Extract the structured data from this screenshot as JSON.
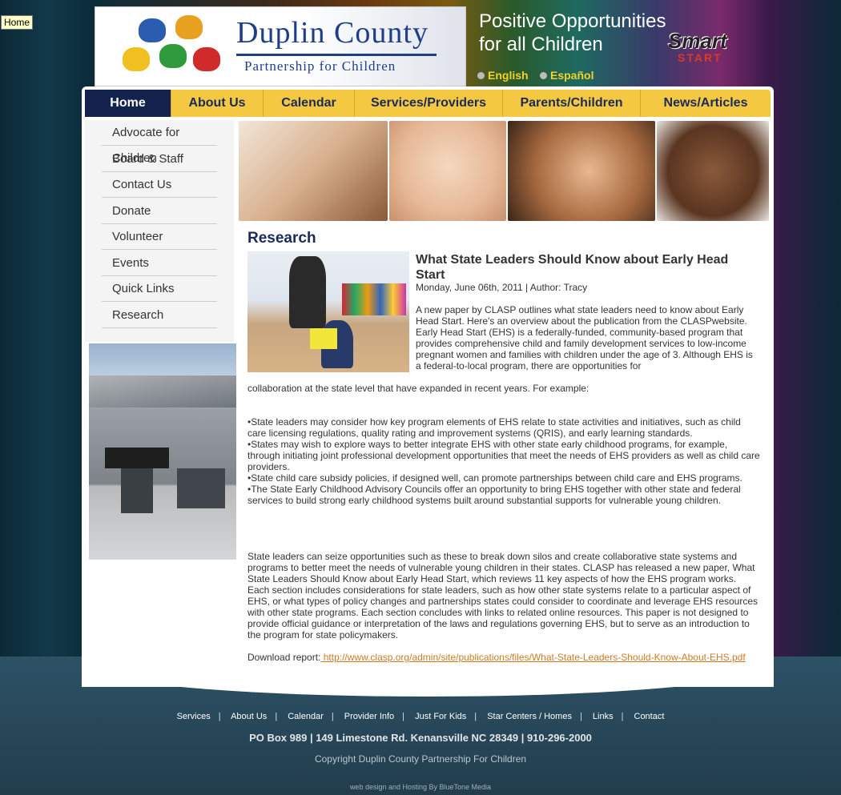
{
  "tooltip": "Home",
  "header": {
    "logo_main": "Duplin County",
    "logo_sub": "Partnership for Children",
    "slogan_line1": "Positive Opportunities",
    "slogan_line2": "for all Children",
    "smart_top": "Smart",
    "smart_bottom": "START",
    "lang_english": "English",
    "lang_spanish": "Español"
  },
  "nav": [
    "Home",
    "About Us",
    "Calendar",
    "Services/Providers",
    "Parents/Children",
    "News/Articles"
  ],
  "sidebar": [
    "Advocate for Children",
    "Board & Staff",
    "Contact Us",
    "Donate",
    "Volunteer",
    "Events",
    "Quick Links",
    "Research"
  ],
  "main": {
    "section_title": "Research",
    "article_title": "What State Leaders Should Know about Early Head Start",
    "meta": "Monday, June 06th, 2011 | Author: Tracy",
    "intro": "A new paper by CLASP outlines what state leaders need to know about Early Head Start. Here's an overview about the publication from the CLASPwebsite. Early Head Start (EHS) is a federally-funded, community-based program that provides comprehensive child and family development services to low-income pregnant women and families with children under the age of 3. Although EHS is a federal-to-local program, there are opportunities for",
    "intro_cont": "collaboration at the state level that have expanded in recent years. For example:",
    "bullets": [
      "•State leaders may consider how key program elements of EHS relate to state activities and initiatives, such as child care licensing regulations, quality rating and improvement systems (QRIS), and early learning standards.",
      "•States may wish to explore ways to better integrate EHS with other state early childhood programs, for example, through initiating joint professional development opportunities that meet the needs of EHS providers as well as child care providers.",
      "•State child care subsidy policies, if designed well, can promote partnerships between child care and EHS programs.",
      "•The State Early Childhood Advisory Councils offer an opportunity to bring EHS together with other state and federal services to build strong early childhood systems built around substantial supports for vulnerable young children."
    ],
    "paragraph": "State leaders can seize opportunities such as these to break down silos and create collaborative state systems and programs to better meet the needs of vulnerable young children in their states. CLASP has released a new paper, What State Leaders Should Know about Early Head Start, which reviews 11 key aspects of how the EHS program works. Each section includes considerations for state leaders, such as how other state systems relate to a particular aspect of EHS, or what types of policy changes and partnerships states could consider to coordinate and leverage EHS resources with other state programs. Each section concludes with links to related online resources. This paper is not designed to provide official guidance or interpretation of the laws and regulations governing EHS, but to serve as an introduction to the program for state policymakers.",
    "download_label": "Download report:",
    "download_link": " http://www.clasp.org/admin/site/publications/files/What-State-Leaders-Should-Know-About-EHS.pdf"
  },
  "footer": {
    "links": [
      "Services",
      "About Us",
      "Calendar",
      "Provider Info",
      "Just For Kids",
      "Star Centers / Homes",
      "Links",
      "Contact"
    ],
    "address": "PO Box 989 | 149 Limestone Rd. Kenansville NC 28349 | 910-296-2000",
    "copyright": "Copyright Duplin County Partnership For Children",
    "credit": "web design and Hosting By BlueTone Media"
  },
  "colors": {
    "nav_bg": "#f5c842",
    "nav_active": "#13234d",
    "title_blue": "#1b2a5a",
    "link": "#d07a20"
  }
}
